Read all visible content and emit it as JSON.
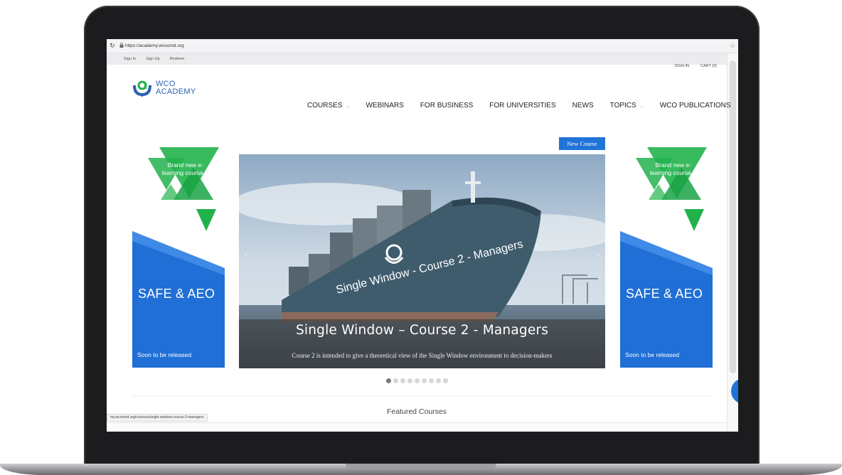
{
  "browser": {
    "url": "https://academy.wcoomd.org",
    "reload_icon": "↻",
    "lock_icon": "🔒",
    "bookmark_icon": "☆"
  },
  "topbar": {
    "links": [
      "Sign In",
      "Sign Up",
      "Redeem"
    ]
  },
  "header": {
    "logo_line1": "WCO",
    "logo_line2": "ACADEMY",
    "sign_in": "SIGN IN",
    "cart": "CART (0)",
    "nav": [
      {
        "label": "COURSES",
        "dropdown": true
      },
      {
        "label": "WEBINARS",
        "dropdown": false
      },
      {
        "label": "FOR BUSINESS",
        "dropdown": false
      },
      {
        "label": "FOR UNIVERSITIES",
        "dropdown": false
      },
      {
        "label": "NEWS",
        "dropdown": false
      },
      {
        "label": "TOPICS",
        "dropdown": true
      },
      {
        "label": "WCO PUBLICATIONS",
        "dropdown": false
      }
    ],
    "caret": "⌄"
  },
  "new_course_button": "New Course",
  "side_ads": {
    "promo": "Brand new e-learning course",
    "title": "SAFE & AEO",
    "footer": "Soon to be released"
  },
  "carousel": {
    "ship_label": "Single Window - Course 2 - Managers",
    "title": "Single Window – Course 2 - Managers",
    "subtitle": "Course 2 is intended to give a theoretical view of the Single Window environment to decision-makers",
    "prev": "‹",
    "next": "›",
    "slide_count": 9,
    "active_slide": 1
  },
  "featured_heading": "Featured Courses",
  "status_bar_url": "my.wcoomd.org/courses/single-window-course-2-managers",
  "colors": {
    "brand_blue": "#1f74d8",
    "brand_green": "#22b24c",
    "logo_blue": "#2a63b0"
  }
}
